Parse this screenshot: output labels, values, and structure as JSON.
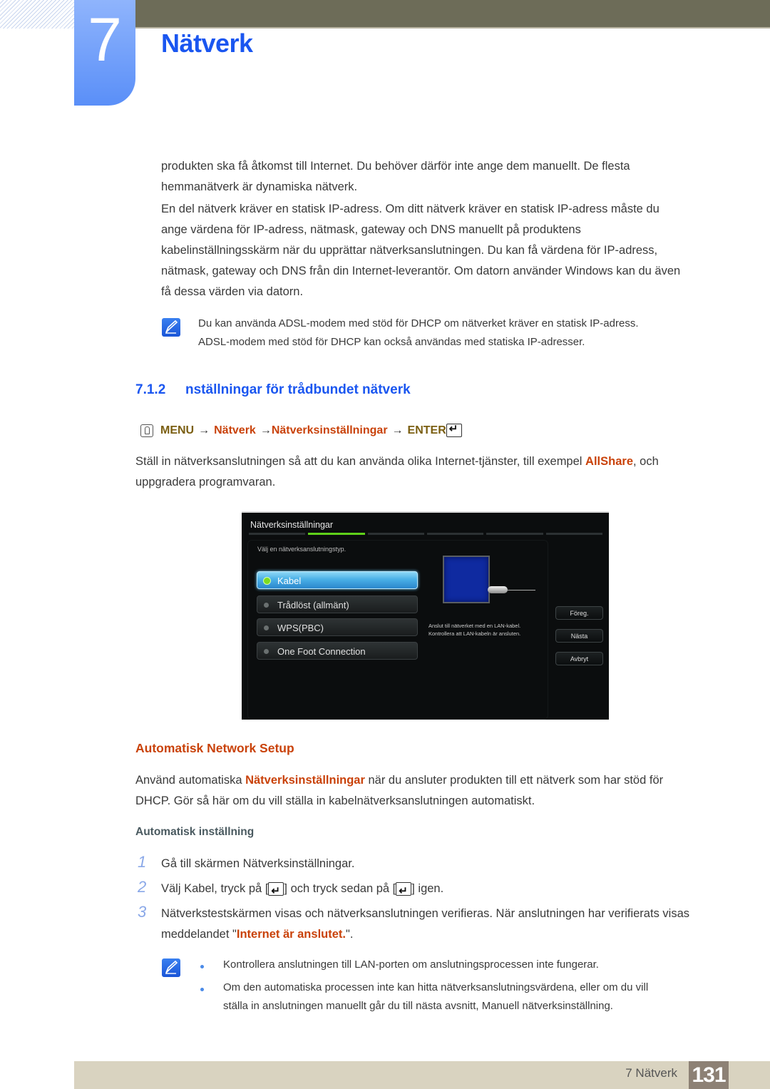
{
  "chapter": {
    "number": "7",
    "title": "Nätverk"
  },
  "intro": {
    "para1": "produkten ska få åtkomst till Internet. Du behöver därför inte ange dem manuellt. De flesta hemmanätverk är dynamiska nätverk.",
    "para2_lines": [
      "En del nätverk kräver en statisk IP-adress. Om ditt nätverk kräver en statisk IP-adress måste du",
      "ange värdena för IP-adress, nätmask, gateway och DNS manuellt på produktens",
      "kabelinställningsskärm när du upprättar nätverksanslutningen. Du kan få värdena för IP-adress,",
      "nätmask, gateway och DNS från din Internet-leverantör. Om datorn använder Windows kan du även",
      "få dessa värden via datorn."
    ],
    "para1_lines": [
      "produkten ska få åtkomst till Internet. Du behöver därför inte ange dem manuellt. De flesta",
      "hemmanätverk är dynamiska nätverk."
    ],
    "note_lines": [
      "Du kan använda ADSL-modem med stöd för DHCP om nätverket kräver en statisk IP-adress.",
      "ADSL-modem med stöd för DHCP kan också användas med statiska IP-adresser."
    ]
  },
  "section": {
    "number": "7.1.2",
    "title": "nställningar för trådbundet nätverk",
    "menu_path": {
      "menu": "MENU",
      "arrow": "→",
      "step1": "Nätverk",
      "step2": "Nätverksinställningar",
      "enter": "ENTER"
    },
    "body_line1_pre": "Ställ in nätverksanslutningen så att du kan använda olika Internet-tjänster, till exempel ",
    "body_highlight": "AllShare",
    "body_line1_post": ", och",
    "body_line2": "uppgradera programvaran."
  },
  "tv_screen": {
    "title": "Nätverksinställningar",
    "prompt": "Välj en nätverksanslutningstyp.",
    "options": [
      {
        "label": "Kabel",
        "selected": true
      },
      {
        "label": "Trådlöst (allmänt)",
        "selected": false
      },
      {
        "label": "WPS(PBC)",
        "selected": false
      },
      {
        "label": "One Foot Connection",
        "selected": false
      }
    ],
    "description_lines": [
      "Anslut till nätverket med en LAN-kabel.",
      "Kontrollera att LAN-kabeln är ansluten."
    ],
    "buttons": {
      "prev": "Föreg.",
      "next": "Nästa",
      "cancel": "Avbryt"
    },
    "progress_step": "2 of 4"
  },
  "auto_setup": {
    "title": "Automatisk Network Setup",
    "line1_pre": "Använd automatiska ",
    "line1_highlight": "Nätverksinställningar",
    "line1_post": " när du ansluter produkten till ett nätverk som har stöd för",
    "line2": "DHCP. Gör så här om du vill ställa in kabelnätverksanslutningen automatiskt.",
    "subheading": "Automatisk inställning",
    "steps": [
      {
        "num": "1",
        "text": "Gå till skärmen Nätverksinställningar."
      },
      {
        "num": "2",
        "pre": "Välj Kabel, tryck på [",
        "mid": "] och tryck sedan på [",
        "post": "] igen."
      },
      {
        "num": "3",
        "line1": "Nätverkstestskärmen visas och nätverksanslutningen verifieras. När anslutningen har verifierats visas",
        "line2_pre": "meddelandet \"",
        "line2_highlight": "Internet är anslutet.",
        "line2_post": "\"."
      }
    ],
    "notes": [
      "Kontrollera anslutningen till LAN-porten om anslutningsprocessen inte fungerar.",
      "Om den automatiska processen inte kan hitta nätverksanslutningsvärdena, eller om du vill",
      "ställa in anslutningen manuellt går du till nästa avsnitt, Manuell nätverksinställning."
    ]
  },
  "footer": {
    "label": "7 Nätverk",
    "page": "131"
  }
}
